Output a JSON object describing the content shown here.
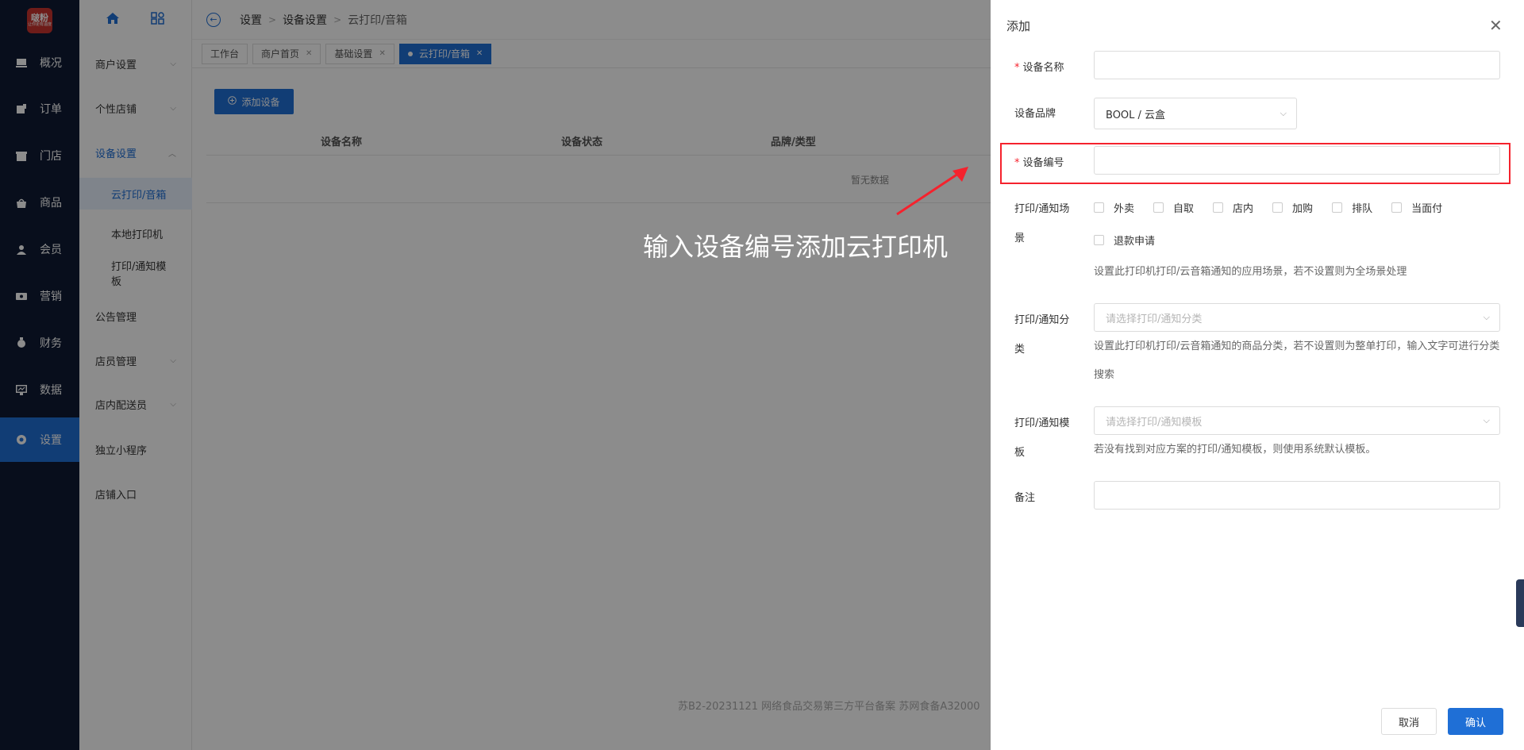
{
  "app": {
    "logo_text": "啵粉",
    "logo_sub": "让你更有温度"
  },
  "rail": {
    "items": [
      {
        "label": "概况",
        "icon": "overview-icon"
      },
      {
        "label": "订单",
        "icon": "order-icon"
      },
      {
        "label": "门店",
        "icon": "store-icon"
      },
      {
        "label": "商品",
        "icon": "goods-icon"
      },
      {
        "label": "会员",
        "icon": "member-icon"
      },
      {
        "label": "营销",
        "icon": "marketing-icon"
      },
      {
        "label": "财务",
        "icon": "finance-icon"
      },
      {
        "label": "数据",
        "icon": "data-icon"
      },
      {
        "label": "设置",
        "icon": "settings-icon"
      }
    ]
  },
  "submenu": {
    "items": [
      {
        "label": "商户设置"
      },
      {
        "label": "个性店铺"
      },
      {
        "label": "设备设置"
      },
      {
        "label": "云打印/音箱"
      },
      {
        "label": "本地打印机"
      },
      {
        "label": "打印/通知模板"
      },
      {
        "label": "公告管理"
      },
      {
        "label": "店员管理"
      },
      {
        "label": "店内配送员"
      },
      {
        "label": "独立小程序"
      },
      {
        "label": "店铺入口"
      }
    ]
  },
  "breadcrumb": [
    "设置",
    "设备设置",
    "云打印/音箱"
  ],
  "tabs": [
    {
      "label": "工作台"
    },
    {
      "label": "商户首页"
    },
    {
      "label": "基础设置"
    },
    {
      "label": "云打印/音箱"
    }
  ],
  "main": {
    "add_button": "添加设备",
    "columns": [
      "设备名称",
      "设备状态",
      "品牌/类型"
    ],
    "empty": "暂无数据",
    "footer": "苏B2-20231121  网络食品交易第三方平台备案 苏网食备A32000"
  },
  "annotation": "输入设备编号添加云打印机",
  "drawer": {
    "title": "添加",
    "fields": {
      "name_label": "设备名称",
      "name_value": "",
      "brand_label": "设备品牌",
      "brand_value": "BOOL / 云盒",
      "code_label": "设备编号",
      "code_value": "",
      "scene_label_1": "打印/通知场",
      "scene_label_2": "景",
      "scene_options": [
        "外卖",
        "自取",
        "店内",
        "加购",
        "排队",
        "当面付"
      ],
      "scene_option_refund": "退款申请",
      "scene_hint": "设置此打印机打印/云音箱通知的应用场景，若不设置则为全场景处理",
      "category_label_1": "打印/通知分",
      "category_label_2": "类",
      "category_placeholder": "请选择打印/通知分类",
      "category_hint": "设置此打印机打印/云音箱通知的商品分类，若不设置则为整单打印，输入文字可进行分类搜索",
      "template_label_1": "打印/通知模",
      "template_label_2": "板",
      "template_placeholder": "请选择打印/通知模板",
      "template_hint": "若没有找到对应方案的打印/通知模板，则使用系统默认模板。",
      "remark_label": "备注",
      "remark_value": ""
    },
    "cancel": "取消",
    "confirm": "确认"
  },
  "colors": {
    "primary": "#1f6fd6",
    "rail": "#0f1b33",
    "highlight": "#f5222d"
  }
}
